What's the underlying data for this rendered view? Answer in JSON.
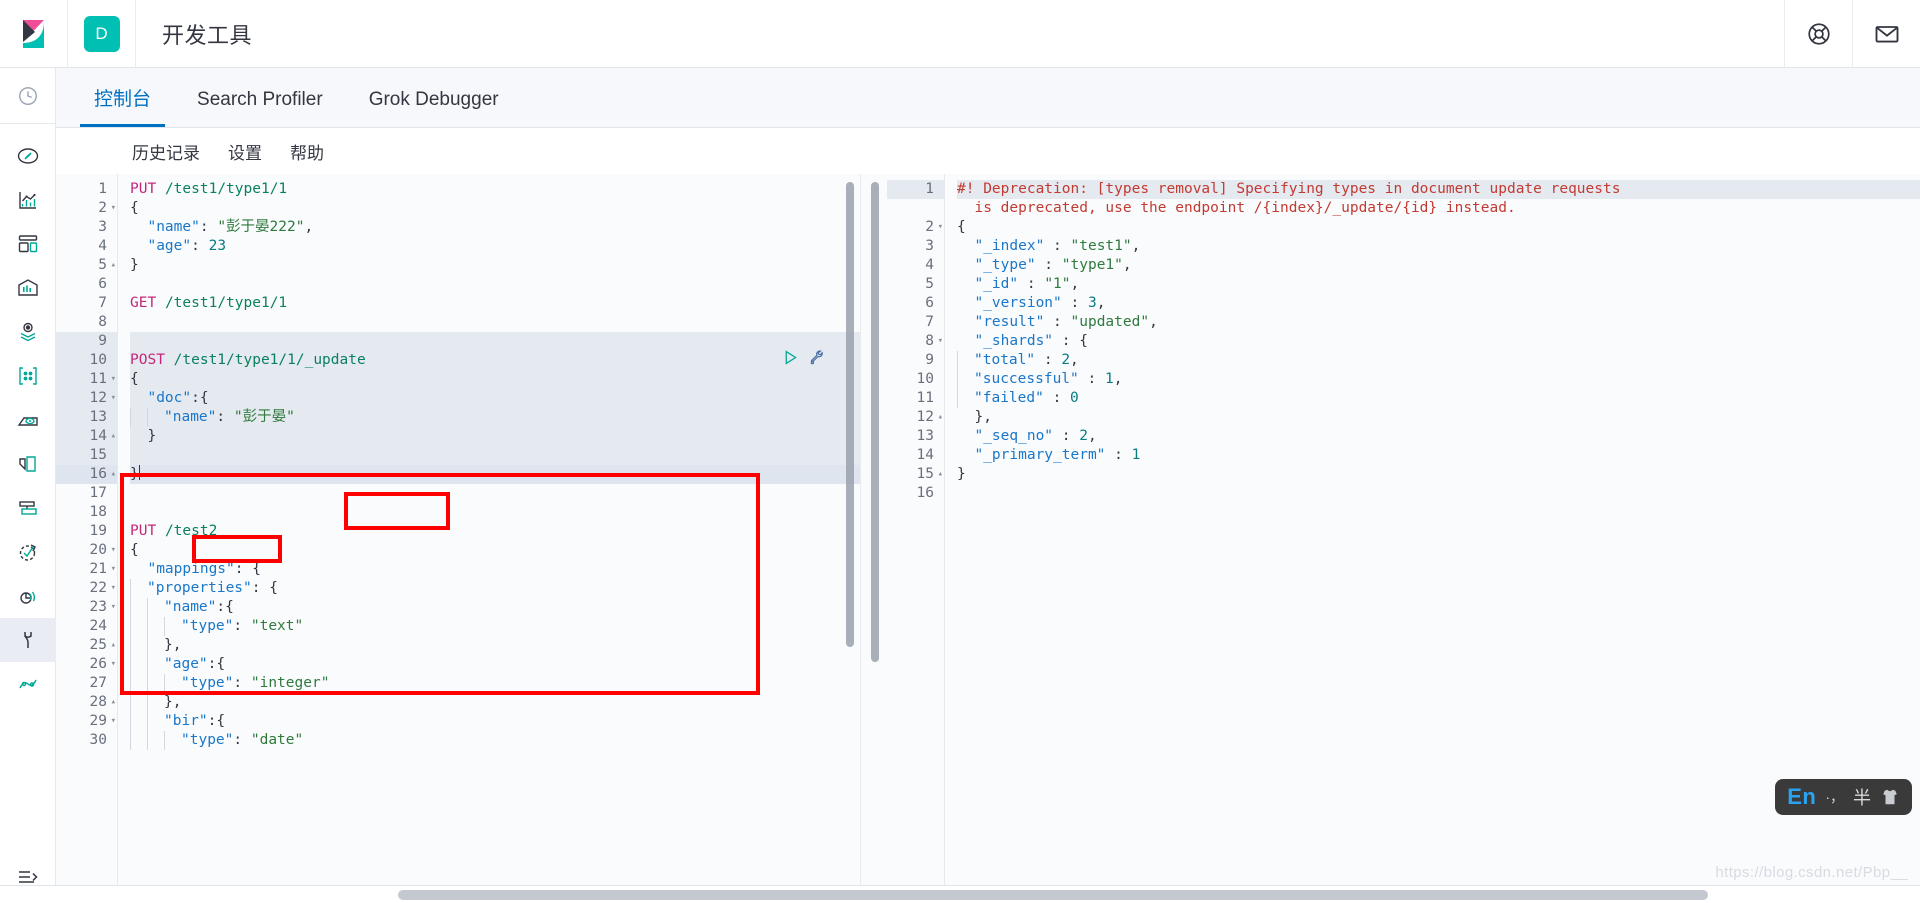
{
  "header": {
    "logo_icon": "kibana-logo-icon",
    "space_initial": "D",
    "title": "开发工具",
    "actions": [
      {
        "name": "help-icon",
        "label": "Help"
      },
      {
        "name": "mail-icon",
        "label": "Mail"
      }
    ]
  },
  "sidebar": {
    "recent_icon": "recently-viewed-clock-icon",
    "collapse_icon": "collapse-sidebar-icon",
    "items": [
      {
        "name": "discover-icon",
        "label": "Discover"
      },
      {
        "name": "visualize-icon",
        "label": "Visualize"
      },
      {
        "name": "dashboard-icon",
        "label": "Dashboard"
      },
      {
        "name": "canvas-icon",
        "label": "Canvas"
      },
      {
        "name": "maps-icon",
        "label": "Maps"
      },
      {
        "name": "machine-learning-icon",
        "label": "Machine Learning"
      },
      {
        "name": "infrastructure-icon",
        "label": "Infrastructure"
      },
      {
        "name": "logs-icon",
        "label": "Logs"
      },
      {
        "name": "apm-icon",
        "label": "APM"
      },
      {
        "name": "uptime-icon",
        "label": "Uptime"
      },
      {
        "name": "siem-icon",
        "label": "SIEM"
      },
      {
        "name": "dev-tools-icon",
        "label": "Dev Tools"
      },
      {
        "name": "management-icon",
        "label": "Management"
      }
    ]
  },
  "tabs": [
    {
      "label": "控制台",
      "active": true
    },
    {
      "label": "Search Profiler",
      "active": false
    },
    {
      "label": "Grok Debugger",
      "active": false
    }
  ],
  "console_menu": [
    {
      "label": "历史记录"
    },
    {
      "label": "设置"
    },
    {
      "label": "帮助"
    }
  ],
  "editor": {
    "actions": [
      {
        "name": "send-request-play-icon",
        "glyph": "▷"
      },
      {
        "name": "wrench-docs-icon",
        "glyph": "wrench"
      }
    ],
    "lines": [
      {
        "n": "1",
        "fold": "",
        "tokens": [
          {
            "t": "method",
            "v": "PUT"
          },
          {
            "t": "punc",
            "v": " "
          },
          {
            "t": "url",
            "v": "/test1/type1/1"
          }
        ]
      },
      {
        "n": "2",
        "fold": "▾",
        "tokens": [
          {
            "t": "punc",
            "v": "{"
          }
        ]
      },
      {
        "n": "3",
        "fold": "",
        "tokens": [
          {
            "t": "punc",
            "v": "  "
          },
          {
            "t": "key",
            "v": "\"name\""
          },
          {
            "t": "punc",
            "v": ": "
          },
          {
            "t": "str",
            "v": "\"彭于晏222\""
          },
          {
            "t": "punc",
            "v": ","
          }
        ]
      },
      {
        "n": "4",
        "fold": "",
        "tokens": [
          {
            "t": "punc",
            "v": "  "
          },
          {
            "t": "key",
            "v": "\"age\""
          },
          {
            "t": "punc",
            "v": ": "
          },
          {
            "t": "num",
            "v": "23"
          }
        ]
      },
      {
        "n": "5",
        "fold": "▴",
        "tokens": [
          {
            "t": "punc",
            "v": "}"
          }
        ]
      },
      {
        "n": "6",
        "fold": "",
        "tokens": []
      },
      {
        "n": "7",
        "fold": "",
        "tokens": [
          {
            "t": "method",
            "v": "GET"
          },
          {
            "t": "punc",
            "v": " "
          },
          {
            "t": "url",
            "v": "/test1/type1/1"
          }
        ]
      },
      {
        "n": "8",
        "fold": "",
        "tokens": []
      },
      {
        "n": "9",
        "fold": "",
        "tokens": [],
        "hl": true
      },
      {
        "n": "10",
        "fold": "",
        "tokens": [
          {
            "t": "method",
            "v": "POST"
          },
          {
            "t": "punc",
            "v": " "
          },
          {
            "t": "url",
            "v": "/test1/type1/1/_update"
          }
        ],
        "hl": true
      },
      {
        "n": "11",
        "fold": "▾",
        "tokens": [
          {
            "t": "punc",
            "v": "{"
          }
        ],
        "hl": true
      },
      {
        "n": "12",
        "fold": "▾",
        "tokens": [
          {
            "t": "punc",
            "v": "  "
          },
          {
            "t": "key",
            "v": "\"doc\""
          },
          {
            "t": "punc",
            "v": ":{"
          }
        ],
        "hl": true
      },
      {
        "n": "13",
        "fold": "",
        "tokens": [
          {
            "t": "guide",
            "v": ""
          },
          {
            "t": "guide",
            "v": ""
          },
          {
            "t": "key",
            "v": "\"name\""
          },
          {
            "t": "punc",
            "v": ": "
          },
          {
            "t": "str",
            "v": "\"彭于晏\""
          }
        ],
        "hl": true
      },
      {
        "n": "14",
        "fold": "▴",
        "tokens": [
          {
            "t": "punc",
            "v": "  }"
          }
        ],
        "hl": true
      },
      {
        "n": "15",
        "fold": "",
        "tokens": [],
        "hl": true
      },
      {
        "n": "16",
        "fold": "▴",
        "tokens": [
          {
            "t": "punc",
            "v": "}"
          },
          {
            "t": "caret",
            "v": ""
          }
        ],
        "hl2": true
      },
      {
        "n": "17",
        "fold": "",
        "tokens": []
      },
      {
        "n": "18",
        "fold": "",
        "tokens": []
      },
      {
        "n": "19",
        "fold": "",
        "tokens": [
          {
            "t": "method",
            "v": "PUT"
          },
          {
            "t": "punc",
            "v": " "
          },
          {
            "t": "url",
            "v": "/test2"
          }
        ]
      },
      {
        "n": "20",
        "fold": "▾",
        "tokens": [
          {
            "t": "punc",
            "v": "{"
          }
        ]
      },
      {
        "n": "21",
        "fold": "▾",
        "tokens": [
          {
            "t": "punc",
            "v": "  "
          },
          {
            "t": "key",
            "v": "\"mappings\""
          },
          {
            "t": "punc",
            "v": ": {"
          }
        ]
      },
      {
        "n": "22",
        "fold": "▾",
        "tokens": [
          {
            "t": "guide",
            "v": ""
          },
          {
            "t": "key",
            "v": "\"properties\""
          },
          {
            "t": "punc",
            "v": ": {"
          }
        ]
      },
      {
        "n": "23",
        "fold": "▾",
        "tokens": [
          {
            "t": "guide",
            "v": ""
          },
          {
            "t": "guide",
            "v": ""
          },
          {
            "t": "key",
            "v": "\"name\""
          },
          {
            "t": "punc",
            "v": ":{"
          }
        ]
      },
      {
        "n": "24",
        "fold": "",
        "tokens": [
          {
            "t": "guide",
            "v": ""
          },
          {
            "t": "guide",
            "v": ""
          },
          {
            "t": "guide",
            "v": ""
          },
          {
            "t": "key",
            "v": "\"type\""
          },
          {
            "t": "punc",
            "v": ": "
          },
          {
            "t": "str",
            "v": "\"text\""
          }
        ]
      },
      {
        "n": "25",
        "fold": "▴",
        "tokens": [
          {
            "t": "guide",
            "v": ""
          },
          {
            "t": "guide",
            "v": ""
          },
          {
            "t": "punc",
            "v": "},"
          }
        ]
      },
      {
        "n": "26",
        "fold": "▾",
        "tokens": [
          {
            "t": "guide",
            "v": ""
          },
          {
            "t": "guide",
            "v": ""
          },
          {
            "t": "key",
            "v": "\"age\""
          },
          {
            "t": "punc",
            "v": ":{"
          }
        ]
      },
      {
        "n": "27",
        "fold": "",
        "tokens": [
          {
            "t": "guide",
            "v": ""
          },
          {
            "t": "guide",
            "v": ""
          },
          {
            "t": "guide",
            "v": ""
          },
          {
            "t": "key",
            "v": "\"type\""
          },
          {
            "t": "punc",
            "v": ": "
          },
          {
            "t": "str",
            "v": "\"integer\""
          }
        ]
      },
      {
        "n": "28",
        "fold": "▴",
        "tokens": [
          {
            "t": "guide",
            "v": ""
          },
          {
            "t": "guide",
            "v": ""
          },
          {
            "t": "punc",
            "v": "},"
          }
        ]
      },
      {
        "n": "29",
        "fold": "▾",
        "tokens": [
          {
            "t": "guide",
            "v": ""
          },
          {
            "t": "guide",
            "v": ""
          },
          {
            "t": "key",
            "v": "\"bir\""
          },
          {
            "t": "punc",
            "v": ":{"
          }
        ]
      },
      {
        "n": "30",
        "fold": "",
        "tokens": [
          {
            "t": "guide",
            "v": ""
          },
          {
            "t": "guide",
            "v": ""
          },
          {
            "t": "guide",
            "v": ""
          },
          {
            "t": "key",
            "v": "\"type\""
          },
          {
            "t": "punc",
            "v": ": "
          },
          {
            "t": "str",
            "v": "\"date\""
          }
        ]
      }
    ]
  },
  "response": {
    "lines": [
      {
        "n": "1",
        "fold": "",
        "tokens": [
          {
            "t": "warn",
            "v": "#! Deprecation: [types removal] Specifying types in document update requests"
          }
        ],
        "hl": true
      },
      {
        "n": "",
        "fold": "",
        "tokens": [
          {
            "t": "warn",
            "v": "  is deprecated, use the endpoint /{index}/_update/{id} instead."
          }
        ]
      },
      {
        "n": "2",
        "fold": "▾",
        "tokens": [
          {
            "t": "punc",
            "v": "{"
          }
        ]
      },
      {
        "n": "3",
        "fold": "",
        "tokens": [
          {
            "t": "punc",
            "v": "  "
          },
          {
            "t": "key",
            "v": "\"_index\""
          },
          {
            "t": "punc",
            "v": " : "
          },
          {
            "t": "str",
            "v": "\"test1\""
          },
          {
            "t": "punc",
            "v": ","
          }
        ]
      },
      {
        "n": "4",
        "fold": "",
        "tokens": [
          {
            "t": "punc",
            "v": "  "
          },
          {
            "t": "key",
            "v": "\"_type\""
          },
          {
            "t": "punc",
            "v": " : "
          },
          {
            "t": "str",
            "v": "\"type1\""
          },
          {
            "t": "punc",
            "v": ","
          }
        ]
      },
      {
        "n": "5",
        "fold": "",
        "tokens": [
          {
            "t": "punc",
            "v": "  "
          },
          {
            "t": "key",
            "v": "\"_id\""
          },
          {
            "t": "punc",
            "v": " : "
          },
          {
            "t": "str",
            "v": "\"1\""
          },
          {
            "t": "punc",
            "v": ","
          }
        ]
      },
      {
        "n": "6",
        "fold": "",
        "tokens": [
          {
            "t": "punc",
            "v": "  "
          },
          {
            "t": "key",
            "v": "\"_version\""
          },
          {
            "t": "punc",
            "v": " : "
          },
          {
            "t": "num",
            "v": "3"
          },
          {
            "t": "punc",
            "v": ","
          }
        ]
      },
      {
        "n": "7",
        "fold": "",
        "tokens": [
          {
            "t": "punc",
            "v": "  "
          },
          {
            "t": "key",
            "v": "\"result\""
          },
          {
            "t": "punc",
            "v": " : "
          },
          {
            "t": "str",
            "v": "\"updated\""
          },
          {
            "t": "punc",
            "v": ","
          }
        ]
      },
      {
        "n": "8",
        "fold": "▾",
        "tokens": [
          {
            "t": "punc",
            "v": "  "
          },
          {
            "t": "key",
            "v": "\"_shards\""
          },
          {
            "t": "punc",
            "v": " : {"
          }
        ]
      },
      {
        "n": "9",
        "fold": "",
        "tokens": [
          {
            "t": "guide",
            "v": ""
          },
          {
            "t": "key",
            "v": "\"total\""
          },
          {
            "t": "punc",
            "v": " : "
          },
          {
            "t": "num",
            "v": "2"
          },
          {
            "t": "punc",
            "v": ","
          }
        ]
      },
      {
        "n": "10",
        "fold": "",
        "tokens": [
          {
            "t": "guide",
            "v": ""
          },
          {
            "t": "key",
            "v": "\"successful\""
          },
          {
            "t": "punc",
            "v": " : "
          },
          {
            "t": "num",
            "v": "1"
          },
          {
            "t": "punc",
            "v": ","
          }
        ]
      },
      {
        "n": "11",
        "fold": "",
        "tokens": [
          {
            "t": "guide",
            "v": ""
          },
          {
            "t": "key",
            "v": "\"failed\""
          },
          {
            "t": "punc",
            "v": " : "
          },
          {
            "t": "num",
            "v": "0"
          }
        ]
      },
      {
        "n": "12",
        "fold": "▴",
        "tokens": [
          {
            "t": "punc",
            "v": "  },"
          }
        ]
      },
      {
        "n": "13",
        "fold": "",
        "tokens": [
          {
            "t": "punc",
            "v": "  "
          },
          {
            "t": "key",
            "v": "\"_seq_no\""
          },
          {
            "t": "punc",
            "v": " : "
          },
          {
            "t": "num",
            "v": "2"
          },
          {
            "t": "punc",
            "v": ","
          }
        ]
      },
      {
        "n": "14",
        "fold": "",
        "tokens": [
          {
            "t": "punc",
            "v": "  "
          },
          {
            "t": "key",
            "v": "\"_primary_term\""
          },
          {
            "t": "punc",
            "v": " : "
          },
          {
            "t": "num",
            "v": "1"
          }
        ]
      },
      {
        "n": "15",
        "fold": "▴",
        "tokens": [
          {
            "t": "punc",
            "v": "}"
          }
        ]
      },
      {
        "n": "16",
        "fold": "",
        "tokens": []
      }
    ]
  },
  "annotations": [
    {
      "name": "annotation-box-request",
      "color": "#ff0000"
    },
    {
      "name": "annotation-box-update-path",
      "color": "#ff0000"
    },
    {
      "name": "annotation-box-doc-key",
      "color": "#ff0000"
    }
  ],
  "ime": {
    "language": "En",
    "punct": "·，",
    "width_mode": "半",
    "skin_icon": "sogou-ime-icon"
  },
  "watermark": "https://blog.csdn.net/Pbp__"
}
